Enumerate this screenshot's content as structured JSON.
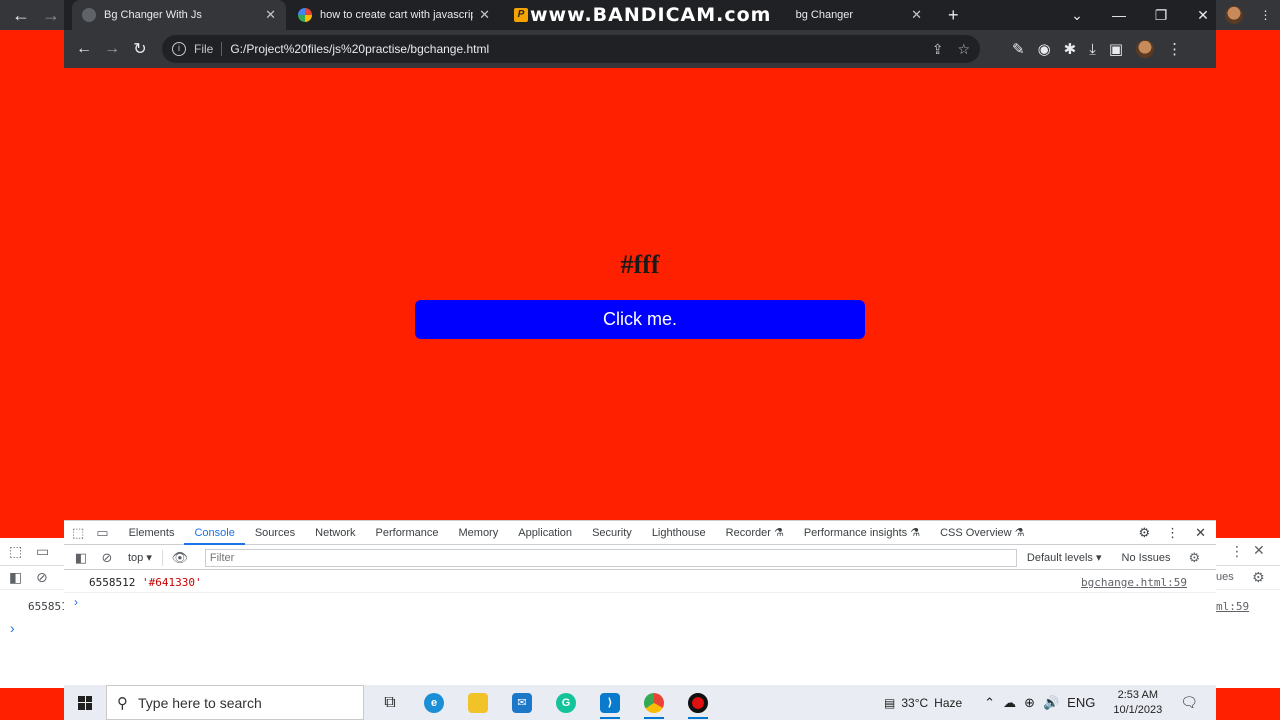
{
  "browser": {
    "tabs": [
      {
        "title": "Bg Changer With Js",
        "active": true
      },
      {
        "title": "how to create cart with javascrip",
        "active": false
      },
      {
        "title": "bg Changer",
        "active": false
      }
    ],
    "overlay_watermark": "www.BANDICAM.com",
    "address": {
      "scheme_label": "File",
      "url": "G:/Project%20files/js%20practise/bgchange.html"
    }
  },
  "page": {
    "hex_text": "#fff",
    "button_label": "Click me.",
    "background_color": "#ff2000",
    "button_color": "#0000ff"
  },
  "devtools": {
    "tabs": [
      "Elements",
      "Console",
      "Sources",
      "Network",
      "Performance",
      "Memory",
      "Application",
      "Security",
      "Lighthouse",
      "Recorder ⚗",
      "Performance insights ⚗",
      "CSS Overview ⚗"
    ],
    "active_tab": "Console",
    "context": "top",
    "filter_placeholder": "Filter",
    "levels": "Default levels",
    "issues": "No Issues",
    "log": {
      "number": "6558512",
      "string": "'#641330'",
      "source": "bgchange.html:59"
    },
    "prompt": "›"
  },
  "outer_devtools": {
    "log_partial": "655851",
    "source_partial": "ml:59",
    "issues_partial": "ues"
  },
  "taskbar": {
    "search_placeholder": "Type here to search",
    "temperature": "33°C",
    "weather": "Haze",
    "language": "ENG",
    "time": "2:53 AM",
    "date": "10/1/2023"
  }
}
